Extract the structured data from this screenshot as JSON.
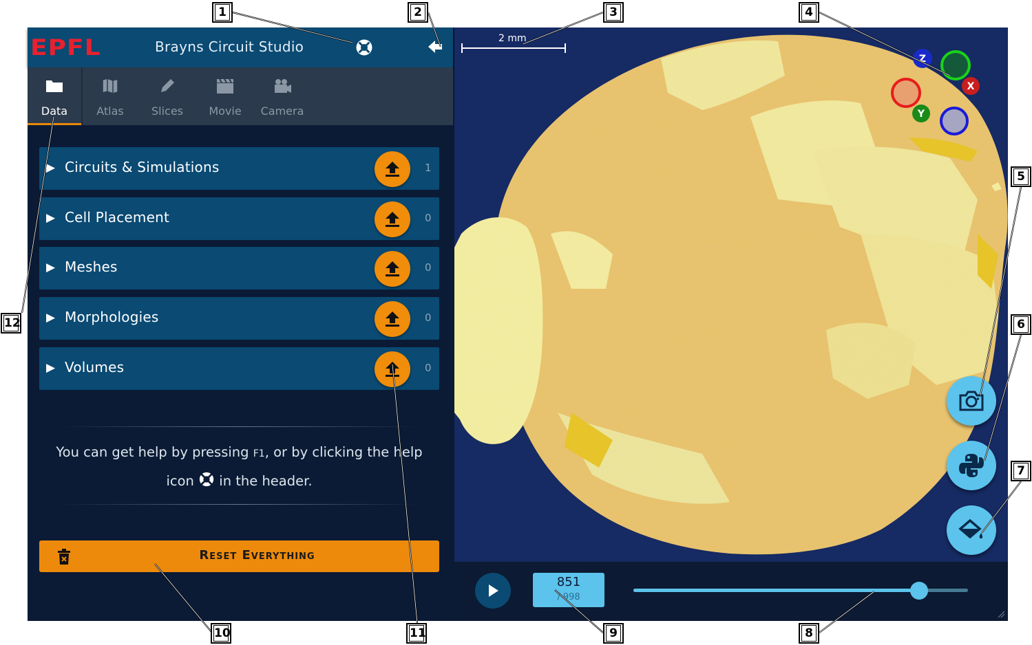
{
  "header": {
    "logo": "EPFL",
    "title": "Brayns Circuit Studio",
    "help_icon": "lifebuoy-icon",
    "back_icon": "back-arrow-icon"
  },
  "tabs": [
    {
      "label": "Data",
      "icon": "folder-icon",
      "active": true
    },
    {
      "label": "Atlas",
      "icon": "map-icon",
      "active": false
    },
    {
      "label": "Slices",
      "icon": "pencil-icon",
      "active": false
    },
    {
      "label": "Movie",
      "icon": "clapperboard-icon",
      "active": false
    },
    {
      "label": "Camera",
      "icon": "video-camera-icon",
      "active": false
    }
  ],
  "sections": [
    {
      "label": "Circuits & Simulations",
      "count": "1"
    },
    {
      "label": "Cell Placement",
      "count": "0"
    },
    {
      "label": "Meshes",
      "count": "0"
    },
    {
      "label": "Morphologies",
      "count": "0"
    },
    {
      "label": "Volumes",
      "count": "0"
    }
  ],
  "help": {
    "part1": "You can get help by pressing ",
    "key": "F1",
    "part2": ", or by clicking the help icon ",
    "part3": " in the header."
  },
  "reset": {
    "label": "Reset Everything",
    "icon": "trash-icon"
  },
  "viewport": {
    "scale_label": "2 mm",
    "axes": {
      "x": "X",
      "y": "Y",
      "z": "Z"
    }
  },
  "fabs": [
    {
      "name": "snapshot",
      "icon": "camera-icon"
    },
    {
      "name": "python",
      "icon": "python-icon"
    },
    {
      "name": "background-color",
      "icon": "paint-bucket-icon"
    }
  ],
  "player": {
    "current_frame": "851",
    "total_frames": "/ 998",
    "progress": 0.853
  },
  "callouts": [
    "1",
    "2",
    "3",
    "4",
    "5",
    "6",
    "7",
    "8",
    "9",
    "10",
    "11",
    "12"
  ],
  "colors": {
    "accent": "#ee8a0b",
    "header_bg": "#0a4a73",
    "fab": "#5cc3ec",
    "logo": "#e8212f"
  }
}
